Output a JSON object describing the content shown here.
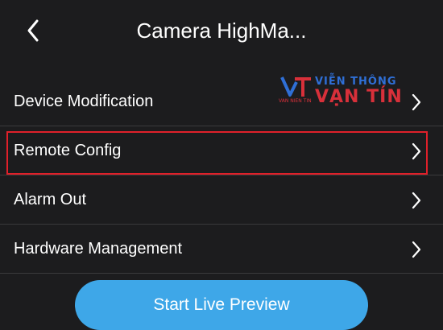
{
  "header": {
    "title": "Camera HighMa...",
    "back_icon": "chevron-left-icon"
  },
  "menu": {
    "items": [
      {
        "label": "Device Modification",
        "icon": "chevron-right-icon"
      },
      {
        "label": "Remote Config",
        "icon": "chevron-right-icon",
        "highlighted": true
      },
      {
        "label": "Alarm Out",
        "icon": "chevron-right-icon"
      },
      {
        "label": "Hardware Management",
        "icon": "chevron-right-icon"
      }
    ]
  },
  "watermark": {
    "line1": "VIỄN THÔNG",
    "line2": "VẠN TÍN",
    "small": "VAN NIEN TIN"
  },
  "footer": {
    "live_button_label": "Start Live Preview"
  },
  "colors": {
    "background": "#1c1c1e",
    "accent": "#3ea7e8",
    "highlight_border": "#e0202a",
    "divider": "#3a3a3c"
  }
}
